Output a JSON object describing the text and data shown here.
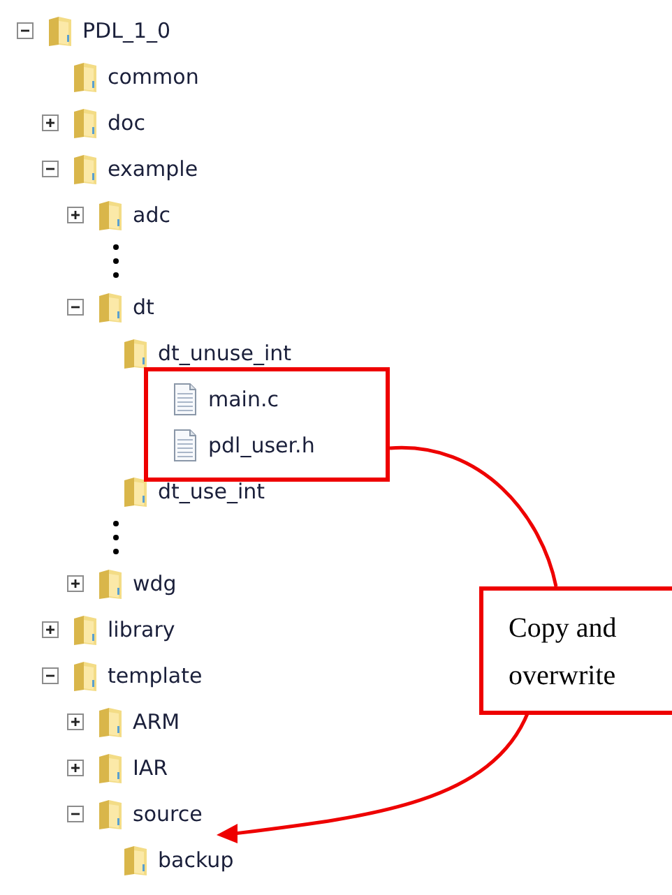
{
  "tree": [
    {
      "kind": "folder",
      "label": "PDL_1_0",
      "expanded": true,
      "children": [
        {
          "kind": "folder",
          "label": "common"
        },
        {
          "kind": "folder",
          "label": "doc",
          "expanded": false
        },
        {
          "kind": "folder",
          "label": "example",
          "expanded": true,
          "children": [
            {
              "kind": "folder",
              "label": "adc",
              "expanded": false
            },
            {
              "kind": "ellipsis"
            },
            {
              "kind": "folder",
              "label": "dt",
              "expanded": true,
              "children": [
                {
                  "kind": "folder",
                  "label": "dt_unuse_int",
                  "children": [
                    {
                      "kind": "file",
                      "label": "main.c"
                    },
                    {
                      "kind": "file",
                      "label": "pdl_user.h"
                    }
                  ]
                },
                {
                  "kind": "folder",
                  "label": "dt_use_int"
                }
              ]
            },
            {
              "kind": "ellipsis"
            },
            {
              "kind": "folder",
              "label": "wdg",
              "expanded": false
            }
          ]
        },
        {
          "kind": "folder",
          "label": "library",
          "expanded": false
        },
        {
          "kind": "folder",
          "label": "template",
          "expanded": true,
          "children": [
            {
              "kind": "folder",
              "label": "ARM",
              "expanded": false
            },
            {
              "kind": "folder",
              "label": "IAR",
              "expanded": false
            },
            {
              "kind": "folder",
              "label": "source",
              "expanded": true,
              "children": [
                {
                  "kind": "folder",
                  "label": "backup"
                }
              ]
            }
          ]
        }
      ]
    }
  ],
  "callout": {
    "text": "Copy and overwrite"
  }
}
